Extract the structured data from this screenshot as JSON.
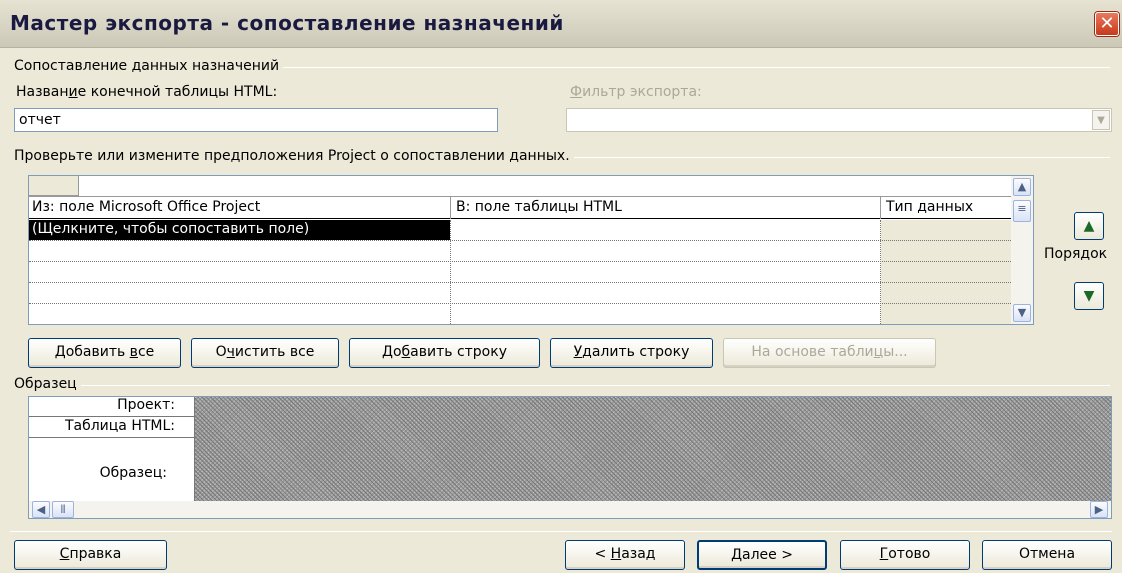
{
  "window": {
    "title": "Мастер экспорта - сопоставление назначений",
    "close_glyph": "✕"
  },
  "mapping_group": {
    "label": "Сопоставление данных назначений"
  },
  "dest_table": {
    "label": "Название конечной таблицы HTML:",
    "value": "отчет"
  },
  "export_filter": {
    "label": "Фильтр экспорта:",
    "value": ""
  },
  "verify_group": {
    "label": "Проверьте или измените предположения Project о сопоставлении данных."
  },
  "grid": {
    "columns": [
      "Из: поле Microsoft Office Project",
      "В:  поле таблицы HTML",
      "Тип данных"
    ],
    "rows": [
      [
        "(Щелкните, чтобы сопоставить поле)",
        "",
        ""
      ],
      [
        "",
        "",
        ""
      ],
      [
        "",
        "",
        ""
      ],
      [
        "",
        "",
        ""
      ],
      [
        "",
        "",
        ""
      ]
    ]
  },
  "order": {
    "label": "Порядок",
    "up_icon": "arrow-up",
    "down_icon": "arrow-down"
  },
  "actions": {
    "add_all": "Добавить все",
    "clear_all": "Очистить все",
    "add_row": "Добавить строку",
    "delete_row": "Удалить строку",
    "base_on_table": "На основе таблицы..."
  },
  "sample": {
    "label": "Образец",
    "rows": [
      "Проект:",
      "Таблица HTML:",
      "Образец:"
    ]
  },
  "footer": {
    "help": "Справка",
    "back": "< Назад",
    "next": "Далее >",
    "finish": "Готово",
    "cancel": "Отмена"
  }
}
